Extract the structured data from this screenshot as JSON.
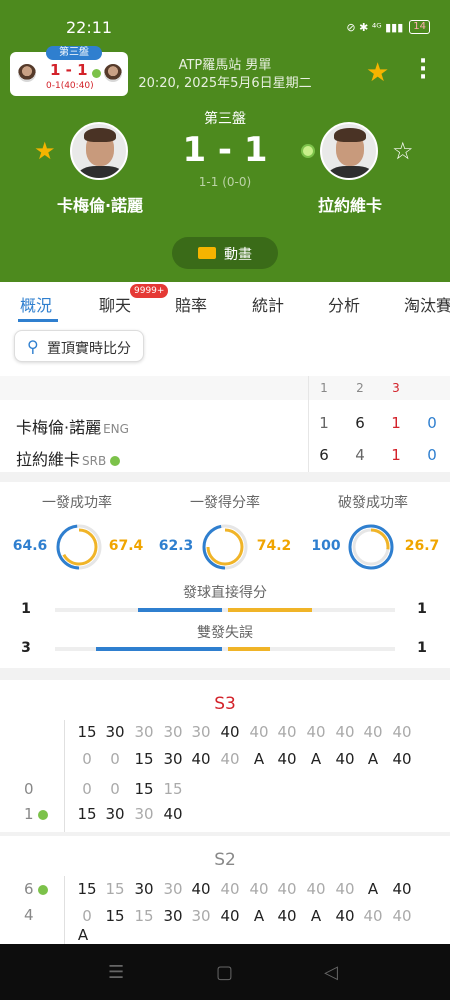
{
  "status": {
    "time": "22:11",
    "icons": "⊘ ✱ ⁴ᴳ ▮▮▮",
    "battery": "14"
  },
  "mini_card": {
    "badge": "第三盤",
    "score": "1 - 1",
    "sub": "0-1(40:40)"
  },
  "header": {
    "league": "ATP羅馬站 男單",
    "datetime": "20:20, 2025年5月6日星期二",
    "set_title": "第三盤",
    "score": "1 - 1",
    "sub_score": "1-1 (0-0)",
    "home_name": "卡梅倫·諾麗",
    "away_name": "拉約維卡",
    "animation_label": "動畫"
  },
  "tabs": [
    {
      "label": "概況"
    },
    {
      "label": "聊天"
    },
    {
      "label": "賠率"
    },
    {
      "label": "統計"
    },
    {
      "label": "分析"
    },
    {
      "label": "淘汰賽"
    }
  ],
  "chat_badge": "9999+",
  "pin_button": "置頂實時比分",
  "scoreboard": {
    "columns": [
      "1",
      "2",
      "3"
    ],
    "rows": [
      {
        "name": "卡梅倫·諾麗",
        "country": "ENG",
        "s1": "1",
        "s2": "6",
        "s3": "1",
        "game": "0"
      },
      {
        "name": "拉約維卡",
        "country": "SRB",
        "s1": "6",
        "s2": "4",
        "s3": "1",
        "game": "0"
      }
    ]
  },
  "stats": {
    "first_serve_pct": {
      "title": "一發成功率",
      "left": "64.6",
      "right": "67.4"
    },
    "first_serve_won": {
      "title": "一發得分率",
      "left": "62.3",
      "right": "74.2"
    },
    "break_pct": {
      "title": "破發成功率",
      "left": "100",
      "right": "26.7"
    },
    "aces": {
      "title": "發球直接得分",
      "left": "1",
      "right": "1"
    },
    "double_faults": {
      "title": "雙發失誤",
      "left": "3",
      "right": "1"
    }
  },
  "pbp": {
    "s3": {
      "title": "S3",
      "row1": [
        "15",
        "30",
        "30",
        "30",
        "30",
        "40",
        "40",
        "40",
        "40",
        "40",
        "40",
        "40"
      ],
      "row2": [
        "0",
        "0",
        "15",
        "30",
        "40",
        "40",
        "A",
        "40",
        "A",
        "40",
        "A",
        "40"
      ],
      "g_home": "0",
      "g_away": "1",
      "g1_home": [
        "0",
        "0",
        "15",
        "15"
      ],
      "g1_away": [
        "15",
        "30",
        "30",
        "40"
      ]
    },
    "s2": {
      "title": "S2",
      "g_home": "6",
      "g_away": "4",
      "row1": [
        "15",
        "15",
        "30",
        "30",
        "40",
        "40",
        "40",
        "40",
        "40",
        "40",
        "A",
        "40"
      ],
      "row2": [
        "0",
        "15",
        "15",
        "30",
        "30",
        "40",
        "A",
        "40",
        "A",
        "40",
        "40",
        "40"
      ],
      "row3": [
        "A"
      ]
    }
  },
  "colors": {
    "header_green": "#4d8a1e",
    "accent_blue": "#2f7fcf",
    "accent_orange": "#f0a500",
    "red": "#d3222a"
  }
}
